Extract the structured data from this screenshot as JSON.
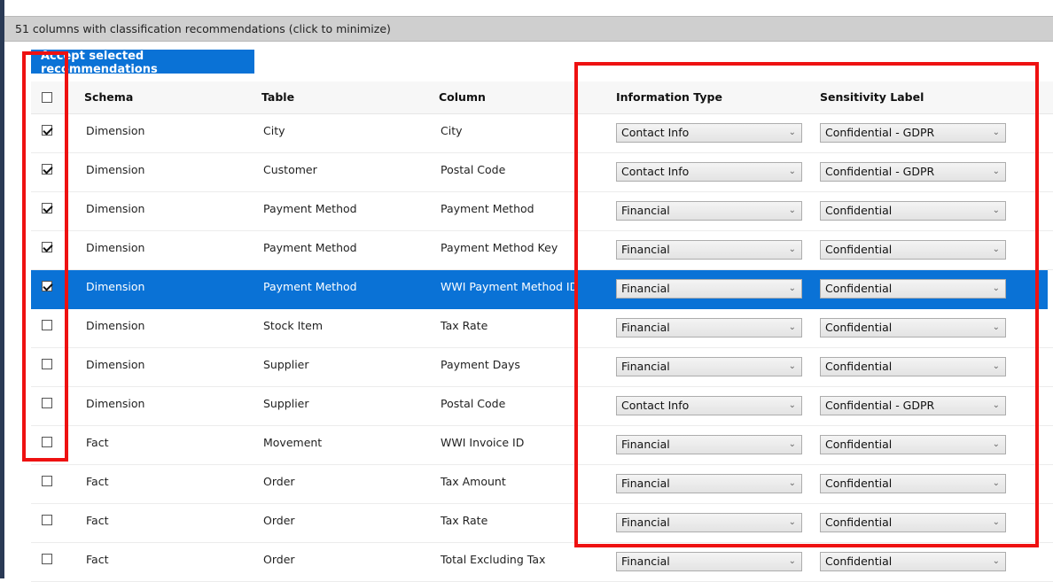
{
  "banner": {
    "text": "51 columns with classification recommendations (click to minimize)"
  },
  "accept_button": {
    "label": "Accept selected recommendations"
  },
  "columns": {
    "schema": "Schema",
    "table": "Table",
    "column": "Column",
    "info_type": "Information Type",
    "sensitivity": "Sensitivity Label"
  },
  "rows": [
    {
      "checked": true,
      "selected": false,
      "schema": "Dimension",
      "table": "City",
      "column": "City",
      "info_type": "Contact Info",
      "sensitivity": "Confidential - GDPR"
    },
    {
      "checked": true,
      "selected": false,
      "schema": "Dimension",
      "table": "Customer",
      "column": "Postal Code",
      "info_type": "Contact Info",
      "sensitivity": "Confidential - GDPR"
    },
    {
      "checked": true,
      "selected": false,
      "schema": "Dimension",
      "table": "Payment Method",
      "column": "Payment Method",
      "info_type": "Financial",
      "sensitivity": "Confidential"
    },
    {
      "checked": true,
      "selected": false,
      "schema": "Dimension",
      "table": "Payment Method",
      "column": "Payment Method Key",
      "info_type": "Financial",
      "sensitivity": "Confidential"
    },
    {
      "checked": true,
      "selected": true,
      "schema": "Dimension",
      "table": "Payment Method",
      "column": "WWI Payment Method ID",
      "info_type": "Financial",
      "sensitivity": "Confidential"
    },
    {
      "checked": false,
      "selected": false,
      "schema": "Dimension",
      "table": "Stock Item",
      "column": "Tax Rate",
      "info_type": "Financial",
      "sensitivity": "Confidential"
    },
    {
      "checked": false,
      "selected": false,
      "schema": "Dimension",
      "table": "Supplier",
      "column": "Payment Days",
      "info_type": "Financial",
      "sensitivity": "Confidential"
    },
    {
      "checked": false,
      "selected": false,
      "schema": "Dimension",
      "table": "Supplier",
      "column": "Postal Code",
      "info_type": "Contact Info",
      "sensitivity": "Confidential - GDPR"
    },
    {
      "checked": false,
      "selected": false,
      "schema": "Fact",
      "table": "Movement",
      "column": "WWI Invoice ID",
      "info_type": "Financial",
      "sensitivity": "Confidential"
    },
    {
      "checked": false,
      "selected": false,
      "schema": "Fact",
      "table": "Order",
      "column": "Tax Amount",
      "info_type": "Financial",
      "sensitivity": "Confidential"
    },
    {
      "checked": false,
      "selected": false,
      "schema": "Fact",
      "table": "Order",
      "column": "Tax Rate",
      "info_type": "Financial",
      "sensitivity": "Confidential"
    },
    {
      "checked": false,
      "selected": false,
      "schema": "Fact",
      "table": "Order",
      "column": "Total Excluding Tax",
      "info_type": "Financial",
      "sensitivity": "Confidential"
    }
  ],
  "colors": {
    "accent": "#0a72d6",
    "highlight": "#ee1111",
    "banner_bg": "#cfcfcf"
  }
}
